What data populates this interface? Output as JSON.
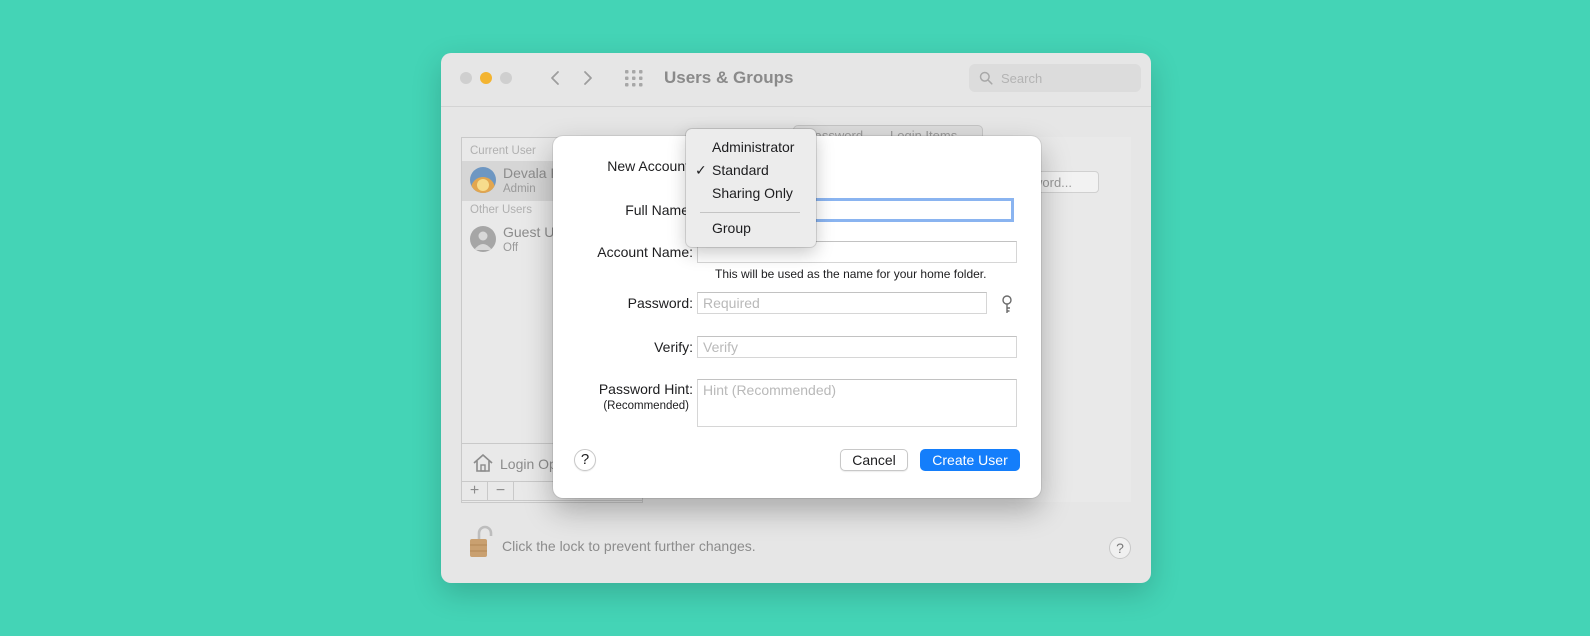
{
  "window": {
    "title": "Users & Groups",
    "search_placeholder": "Search"
  },
  "sidebar": {
    "current_user_label": "Current User",
    "other_users_label": "Other Users",
    "users": [
      {
        "name": "Devala F",
        "role": "Admin"
      },
      {
        "name": "Guest U",
        "role": "Off"
      }
    ],
    "login_options_label": "Login Op",
    "add": "+",
    "remove": "−"
  },
  "behind": {
    "tabs": [
      "Password",
      "Login Items"
    ],
    "change_password_label": "ssword...",
    "lock_text": "Click the lock to prevent further changes.",
    "help": "?"
  },
  "sheet": {
    "new_account_label": "New Account",
    "full_name_label": "Full Name",
    "account_name_label": "Account Name:",
    "account_name_helper": "This will be used as the name for your home folder.",
    "password_label": "Password:",
    "password_placeholder": "Required",
    "verify_label": "Verify:",
    "verify_placeholder": "Verify",
    "hint_label": "Password Hint:",
    "hint_sub": "(Recommended)",
    "hint_placeholder": "Hint (Recommended)",
    "help": "?",
    "cancel": "Cancel",
    "create": "Create User"
  },
  "account_menu": {
    "items": [
      "Administrator",
      "Standard",
      "Sharing Only",
      "Group"
    ],
    "selected": "Standard",
    "checkmark": "✓"
  },
  "colors": {
    "background": "#44d4b6",
    "accent": "#147efb"
  }
}
